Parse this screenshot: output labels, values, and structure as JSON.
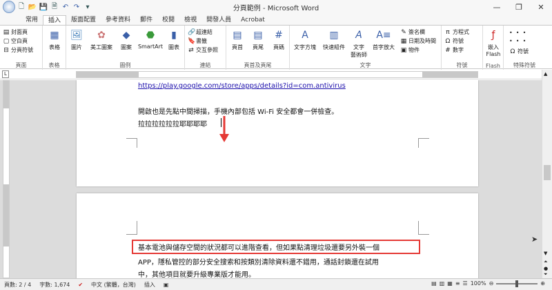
{
  "window": {
    "title": "分頁範例 - Microsoft Word"
  },
  "tabs": [
    "常用",
    "插入",
    "版面配置",
    "參考資料",
    "郵件",
    "校閱",
    "檢視",
    "開發人員",
    "Acrobat"
  ],
  "active_tab": "插入",
  "ribbon": {
    "pages": {
      "cover": "封面頁",
      "blank": "空白頁",
      "break": "分頁符號",
      "label": "頁面"
    },
    "tables": {
      "table": "表格",
      "label": "表格"
    },
    "illustrations": {
      "picture": "圖片",
      "clipart": "美工圖案",
      "shapes": "圖案",
      "smartart": "SmartArt",
      "chart": "圖表",
      "label": "圖例"
    },
    "links": {
      "hyperlink": "超連結",
      "bookmark": "書籤",
      "crossref": "交互參照",
      "label": "連結"
    },
    "headerfooter": {
      "header": "頁首",
      "footer": "頁尾",
      "pagenum": "頁碼",
      "label": "頁首及頁尾"
    },
    "text": {
      "textbox": "文字方塊",
      "quickparts": "快速組件",
      "wordart1": "文字",
      "wordart2": "藝術師",
      "dropcap": "首字放大",
      "sigline": "簽名欄",
      "datetime": "日期及時間",
      "object": "物件",
      "label": "文字"
    },
    "symbols": {
      "equation": "方程式",
      "symbol": "符號",
      "number": "數字",
      "label": "符號"
    },
    "flash": {
      "embed1": "嵌入",
      "embed2": "Flash",
      "label": "Flash"
    },
    "special": {
      "symbol": "符號",
      "label": "特殊符號"
    }
  },
  "document": {
    "page1": {
      "link": "https://play.google.com/store/apps/details?id=com.antivirus",
      "line1": "開啟也是先點中間掃描，手機內部包括 Wi-Fi 安全都會一併檢查。",
      "line2": "拉拉拉拉拉拉耶耶耶耶"
    },
    "page2": {
      "line1": "基本電池與儲存空間的狀況都可以進階查看，但如果點清理垃圾還要另外裝一個",
      "line2": "APP，隱私管控的部分安全搜索和按類別清除資料還不錯用，通話封鎖還在試用",
      "line3": "中，其他項目就要升級專業版才能用。"
    }
  },
  "status": {
    "page": "頁數: 2 / 4",
    "words": "字數: 1,674",
    "language": "中文 (繁體，台灣)",
    "mode": "插入",
    "zoom": "100%"
  },
  "colors": {
    "highlight_box": "#e53935",
    "arrow": "#e53935",
    "link": "#1a0dab"
  }
}
